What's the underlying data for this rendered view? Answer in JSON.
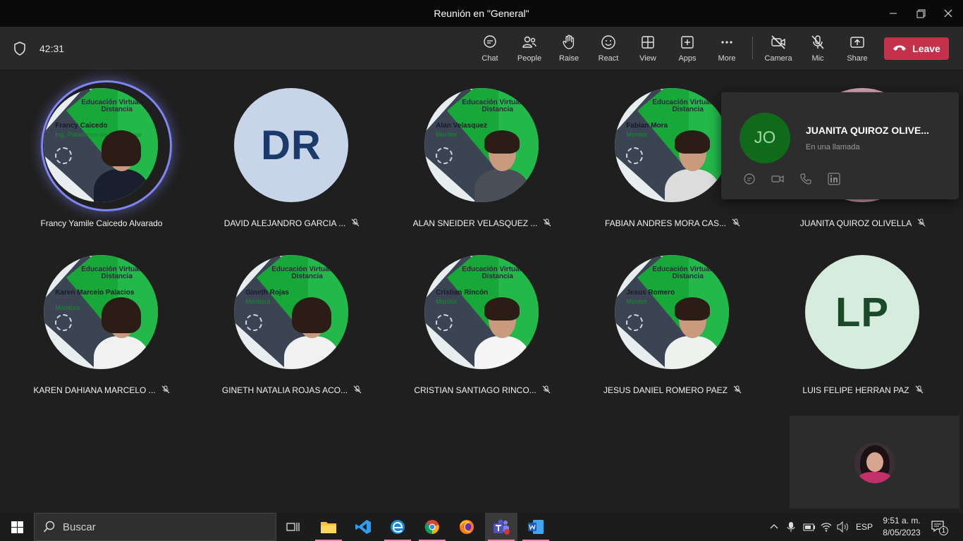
{
  "window": {
    "title": "Reunión en \"General\""
  },
  "toolbar": {
    "timer": "42:31",
    "buttons": [
      {
        "label": "Chat",
        "icon": "chat-icon"
      },
      {
        "label": "People",
        "icon": "people-icon"
      },
      {
        "label": "Raise",
        "icon": "hand-icon"
      },
      {
        "label": "React",
        "icon": "smile-icon"
      },
      {
        "label": "View",
        "icon": "grid-icon"
      },
      {
        "label": "Apps",
        "icon": "add-app-icon"
      },
      {
        "label": "More",
        "icon": "more-icon"
      },
      {
        "label": "Camera",
        "icon": "camera-off-icon"
      },
      {
        "label": "Mic",
        "icon": "mic-off-icon"
      },
      {
        "label": "Share",
        "icon": "share-icon"
      }
    ],
    "leave_label": "Leave",
    "leave_color": "#c4314b"
  },
  "participants": [
    {
      "name": "Francy Yamile Caicedo Alvarado",
      "type": "photo",
      "muted": false,
      "speaking": true,
      "card_name": "Francy Caicedo",
      "card_role": "Ing. Plataforma de Aprendizaje"
    },
    {
      "name": "DAVID ALEJANDRO GARCIA ...",
      "type": "initials",
      "initials": "DR",
      "bg": "#c8d4e8",
      "fg": "#1b3a6b",
      "muted": true
    },
    {
      "name": "ALAN SNEIDER VELASQUEZ ...",
      "type": "photo",
      "muted": true,
      "card_name": "Alan Velasquez",
      "card_role": "Monitor"
    },
    {
      "name": "FABIAN ANDRES MORA CAS...",
      "type": "photo",
      "muted": true,
      "card_name": "Fabian Mora",
      "card_role": "Monitor"
    },
    {
      "name": "JUANITA QUIROZ OLIVELLA",
      "type": "hidden",
      "muted": true
    },
    {
      "name": "KAREN DAHIANA MARCELO ...",
      "type": "photo",
      "muted": true,
      "card_name": "Karen Marcelo Palacios",
      "card_role": "Monitora"
    },
    {
      "name": "GINETH NATALIA ROJAS ACO...",
      "type": "photo",
      "muted": true,
      "card_name": "Gineth Rojas",
      "card_role": "Monitora"
    },
    {
      "name": "CRISTIAN SANTIAGO RINCO...",
      "type": "photo",
      "muted": true,
      "card_name": "Cristian Rincón",
      "card_role": "Monitor"
    },
    {
      "name": "JESUS DANIEL ROMERO PAEZ",
      "type": "photo",
      "muted": true,
      "card_name": "Jesus Romero",
      "card_role": "Monitor"
    },
    {
      "name": "LUIS FELIPE HERRAN PAZ",
      "type": "initials",
      "initials": "LP",
      "bg": "#d6ecdc",
      "fg": "#1a4a2a",
      "muted": true
    }
  ],
  "brand_text": "Educación Virtual y a Distancia",
  "profile_card": {
    "initials": "JO",
    "name": "JUANITA QUIROZ OLIVE...",
    "status": "En una llamada"
  },
  "taskbar": {
    "search_placeholder": "Buscar",
    "language": "ESP",
    "time": "9:51 a. m.",
    "date": "8/05/2023",
    "notification_count": "1"
  }
}
